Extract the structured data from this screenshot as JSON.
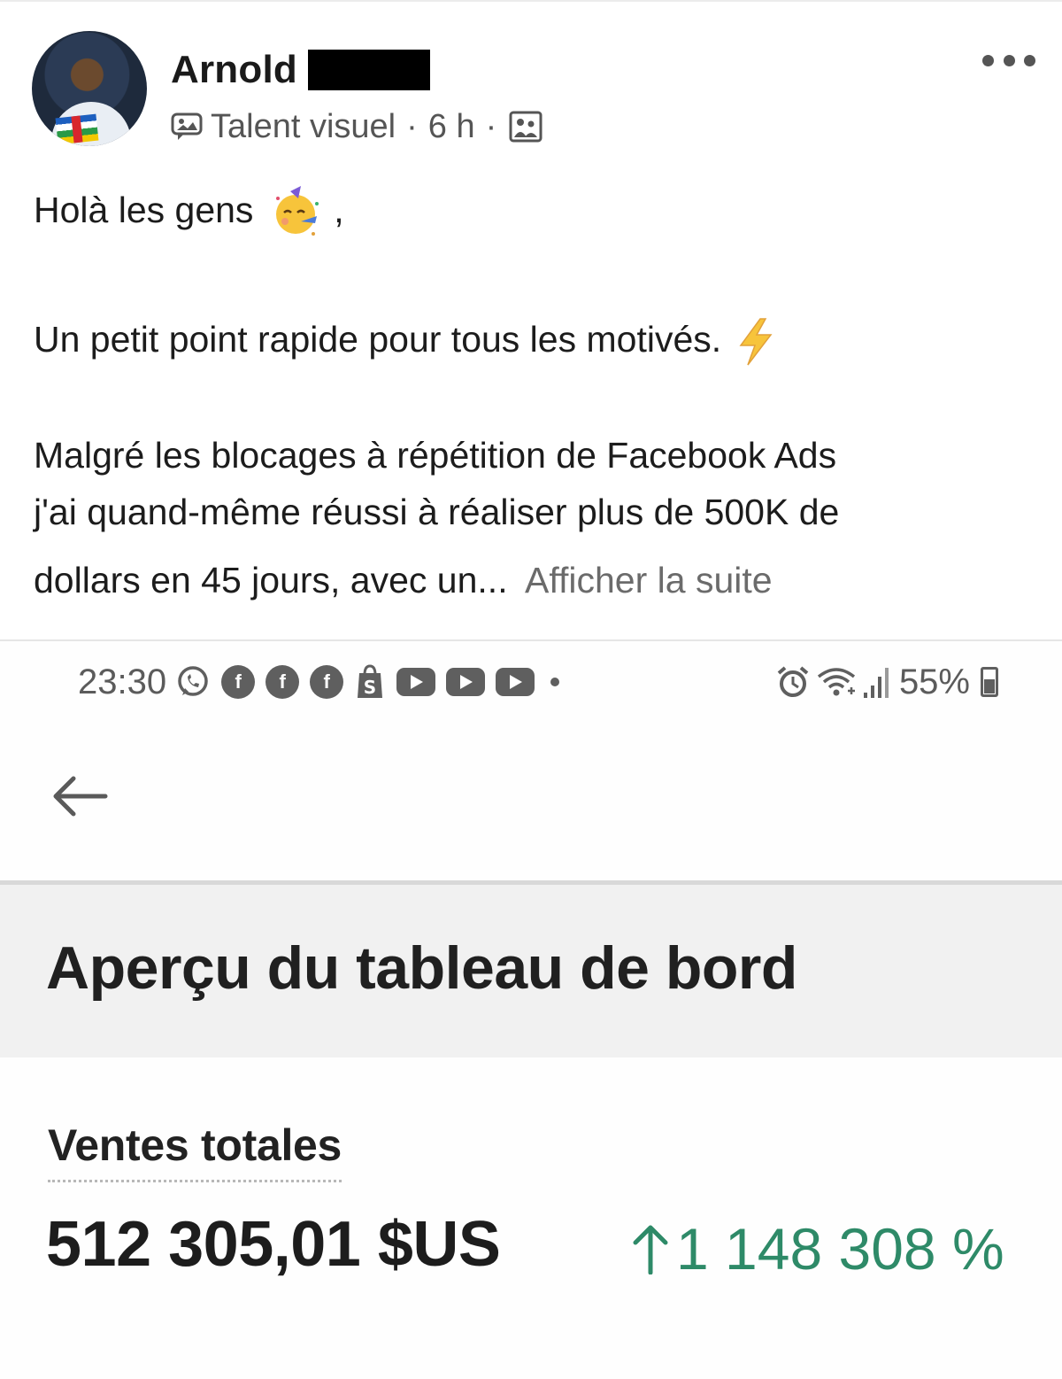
{
  "post": {
    "author": {
      "name": "Arnold"
    },
    "meta": {
      "badge": "Talent visuel",
      "separator": "·",
      "time": "6 h",
      "separator2": "·"
    },
    "text": {
      "greeting": "Holà les gens",
      "greeting_suffix": ",",
      "line2": "Un petit point rapide pour tous les motivés.",
      "line3": "Malgré les blocages à répétition de Facebook Ads",
      "line4": "j'ai quand-même réussi à réaliser plus de 500K de",
      "line5": "dollars en 45 jours, avec un...",
      "see_more": "Afficher la suite"
    },
    "icons": {
      "more": "more-options-icon",
      "badge": "talent-badge-icon",
      "audience": "photo-audience-icon",
      "emoji_party": "partying-face-emoji",
      "emoji_bolt": "lightning-emoji"
    }
  },
  "screenshot": {
    "status_bar": {
      "time": "23:30",
      "battery": "55%"
    },
    "dashboard": {
      "title": "Aperçu du tableau de bord",
      "sales_label": "Ventes totales",
      "sales_value": "512 305,01 $US",
      "sales_change": "1 148 308 %"
    },
    "colors": {
      "positive_change": "#2e8a68"
    }
  }
}
